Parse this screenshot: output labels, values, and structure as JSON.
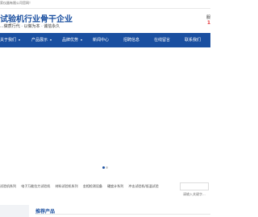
{
  "topbar": {
    "welcome": "家仪器有限公司官网！"
  },
  "brand": {
    "title": "试验机行业骨干企业",
    "slogan": "...做质行代 · 以做为本 · 诚信永久"
  },
  "hotline": {
    "line1": "服",
    "line2": "1"
  },
  "nav": {
    "items": [
      {
        "label": "关于我们",
        "has_caret": true
      },
      {
        "label": "产品展示",
        "has_caret": true
      },
      {
        "label": "品牌优势",
        "has_caret": true
      },
      {
        "label": "新闻中心",
        "has_caret": false
      },
      {
        "label": "招聘信息",
        "has_caret": false
      },
      {
        "label": "在线留言",
        "has_caret": false
      },
      {
        "label": "联系我们",
        "has_caret": false
      }
    ]
  },
  "banner": {
    "slide_count": 2,
    "active_index": 0
  },
  "hotbar": {
    "links": [
      "试验机系列",
      "电子万能拉力试验机",
      "材料试验机系列",
      "金相检测设备",
      "硬度计系列",
      "冲击试验机/低温试验"
    ],
    "search_placeholder": "请输入关键字..."
  },
  "section": {
    "title": "推荐产品"
  },
  "colors": {
    "brand_blue": "#1a4fa0",
    "accent_red": "#e4393c"
  }
}
